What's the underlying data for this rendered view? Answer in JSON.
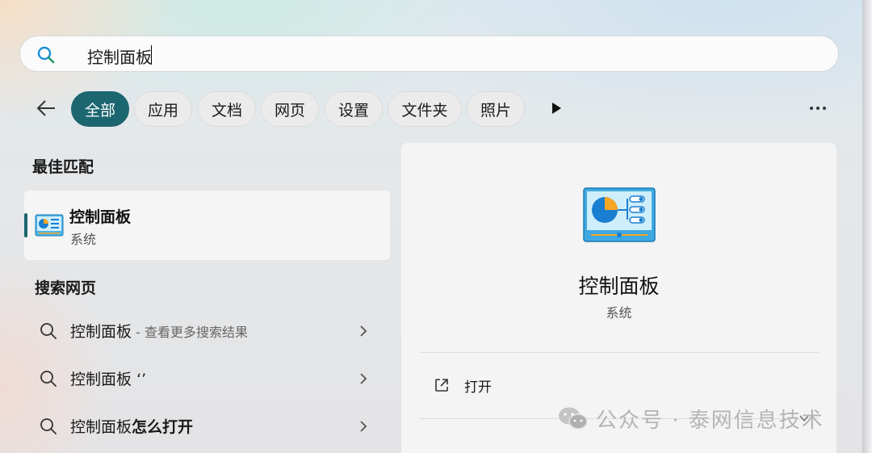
{
  "search": {
    "query": "控制面板"
  },
  "filters": {
    "tabs": [
      {
        "label": "全部",
        "active": true
      },
      {
        "label": "应用"
      },
      {
        "label": "文档"
      },
      {
        "label": "网页"
      },
      {
        "label": "设置"
      },
      {
        "label": "文件夹"
      },
      {
        "label": "照片"
      }
    ]
  },
  "best_match": {
    "section_title": "最佳匹配",
    "item": {
      "title": "控制面板",
      "subtitle": "系统",
      "icon": "control-panel-icon"
    }
  },
  "web_search": {
    "section_title": "搜索网页",
    "items": [
      {
        "query": "控制面板",
        "suffix": " - 查看更多搜索结果"
      },
      {
        "query": "控制面板 ‘’"
      },
      {
        "query": "控制面板",
        "bold_suffix": "怎么打开"
      }
    ]
  },
  "detail": {
    "title": "控制面板",
    "subtitle": "系统",
    "actions": [
      {
        "label": "打开",
        "icon": "open-external-icon"
      }
    ]
  },
  "watermark": {
    "text": "公众号 · 泰网信息技术"
  },
  "colors": {
    "accent": "#1c6670",
    "panel": "#f4f4f4",
    "chip": "#ebebeb"
  }
}
